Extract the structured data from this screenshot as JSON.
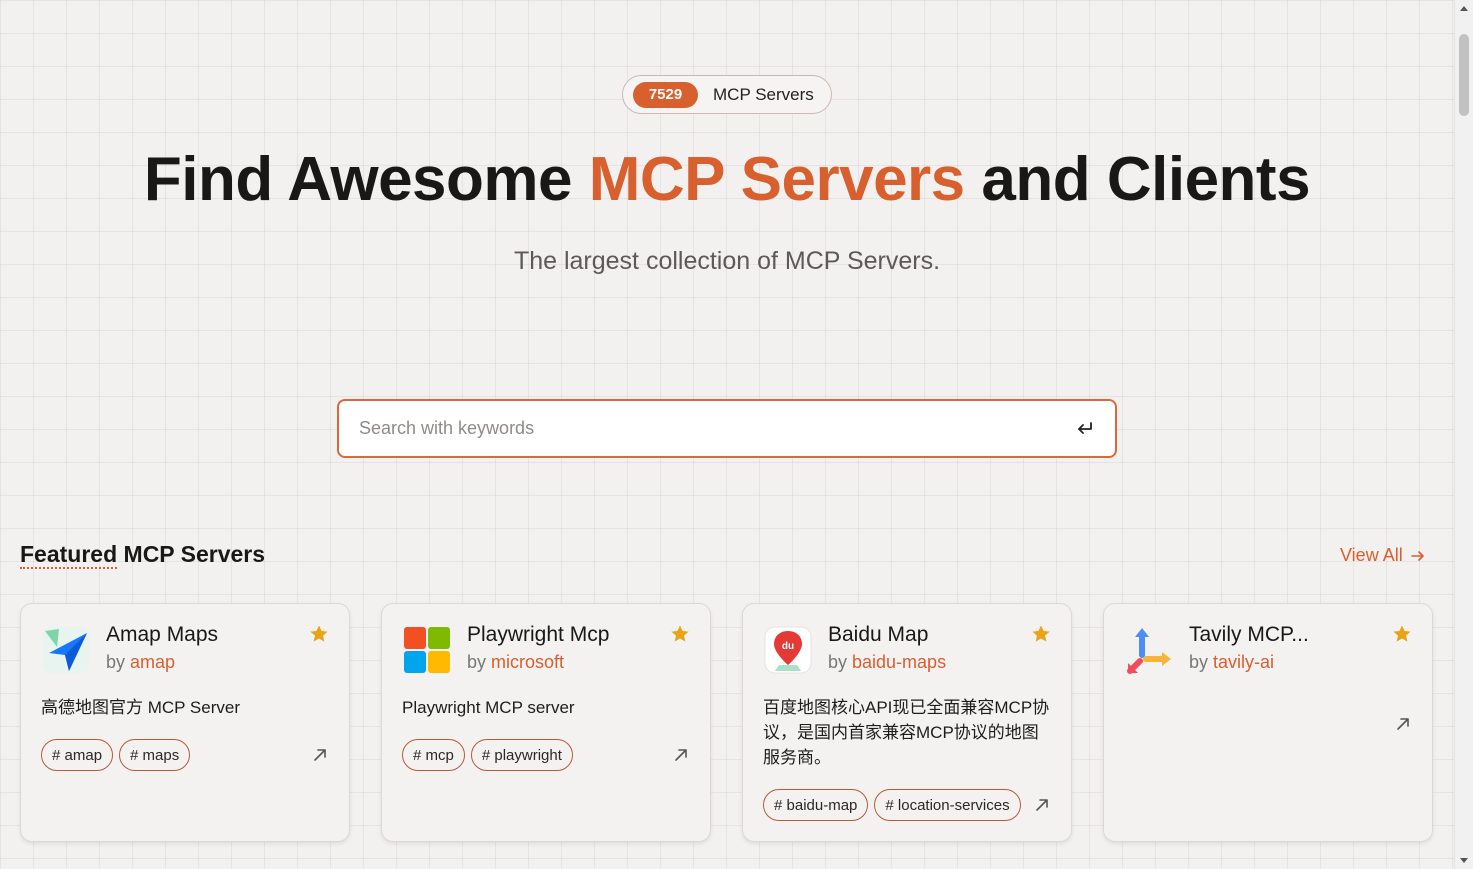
{
  "hero": {
    "count": "7529",
    "count_label": "MCP Servers",
    "title_before": "Find Awesome ",
    "title_accent": "MCP Servers",
    "title_after": " and Clients",
    "subtitle": "The largest collection of MCP Servers."
  },
  "search": {
    "placeholder": "Search with keywords",
    "value": ""
  },
  "featured": {
    "title_underlined": "Featured",
    "title_rest": " MCP Servers",
    "view_all": "View All"
  },
  "cards": [
    {
      "name": "Amap Maps",
      "by": "by ",
      "author": "amap",
      "description": "高德地图官方 MCP Server",
      "tags": [
        "# amap",
        "# maps"
      ],
      "logo": "amap-logo-icon"
    },
    {
      "name": "Playwright Mcp",
      "by": "by ",
      "author": "microsoft",
      "description": "Playwright MCP server",
      "tags": [
        "# mcp",
        "# playwright"
      ],
      "logo": "microsoft-logo-icon"
    },
    {
      "name": "Baidu Map",
      "by": "by ",
      "author": "baidu-maps",
      "description": "百度地图核心API现已全面兼容MCP协议，是国内首家兼容MCP协议的地图服务商。",
      "tags": [
        "# baidu-map",
        "# location-services"
      ],
      "logo": "baidu-map-logo-icon"
    },
    {
      "name": "Tavily MCP...",
      "by": "by ",
      "author": "tavily-ai",
      "description": "",
      "tags": [],
      "logo": "tavily-logo-icon"
    }
  ],
  "colors": {
    "accent": "#d85f2e",
    "star": "#e8a317",
    "background": "#f3f1ef"
  }
}
